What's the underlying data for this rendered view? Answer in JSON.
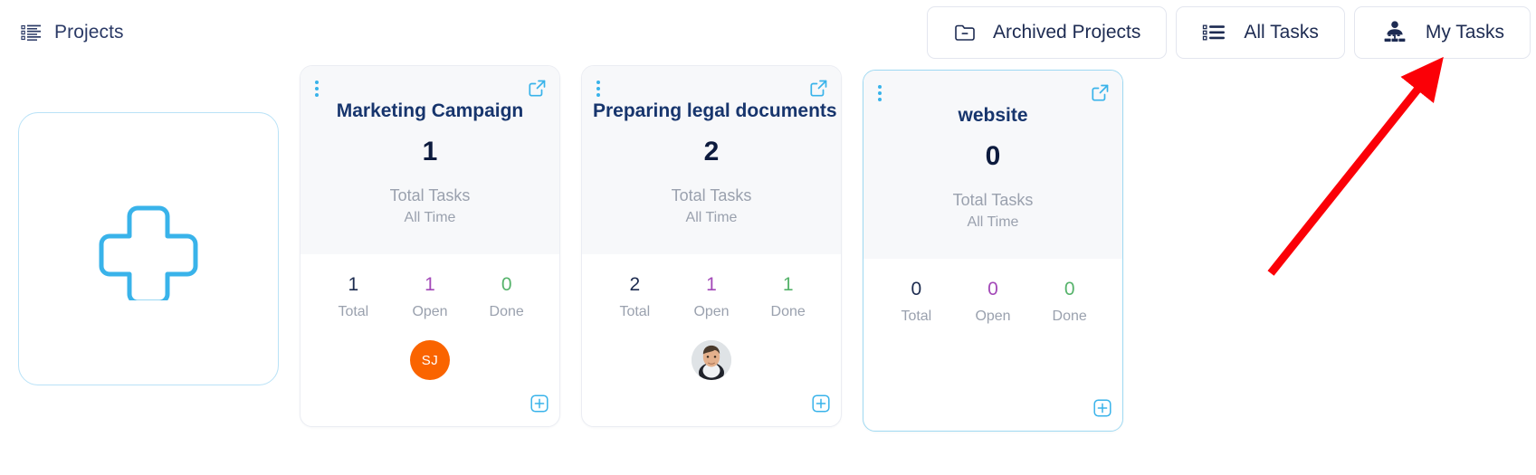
{
  "header": {
    "title": "Projects",
    "title_icon": "list-icon",
    "buttons": [
      {
        "label": "Archived Projects",
        "icon": "folder-minus-icon",
        "name": "archived-projects-button"
      },
      {
        "label": "All Tasks",
        "icon": "list-bullets-icon",
        "name": "all-tasks-button"
      },
      {
        "label": "My Tasks",
        "icon": "org-person-icon",
        "name": "my-tasks-button"
      }
    ]
  },
  "add_card": {
    "icon": "plus-icon",
    "label": ""
  },
  "cards": [
    {
      "title": "Marketing Campaign",
      "count": "1",
      "metric_label": "Total Tasks",
      "metric_sub": "All Time",
      "stats": [
        {
          "num": "1",
          "cap": "Total",
          "kind": "total"
        },
        {
          "num": "1",
          "cap": "Open",
          "kind": "open"
        },
        {
          "num": "0",
          "cap": "Done",
          "kind": "done"
        }
      ],
      "avatar": {
        "type": "initials",
        "initials": "SJ",
        "color": "#fa6400"
      },
      "selected": false
    },
    {
      "title": "Preparing legal documents",
      "count": "2",
      "metric_label": "Total Tasks",
      "metric_sub": "All Time",
      "stats": [
        {
          "num": "2",
          "cap": "Total",
          "kind": "total"
        },
        {
          "num": "1",
          "cap": "Open",
          "kind": "open"
        },
        {
          "num": "1",
          "cap": "Done",
          "kind": "done"
        }
      ],
      "avatar": {
        "type": "photo",
        "initials": "",
        "color": "#d9dde2"
      },
      "selected": false
    },
    {
      "title": "website",
      "count": "0",
      "metric_label": "Total Tasks",
      "metric_sub": "All Time",
      "stats": [
        {
          "num": "0",
          "cap": "Total",
          "kind": "total"
        },
        {
          "num": "0",
          "cap": "Open",
          "kind": "open"
        },
        {
          "num": "0",
          "cap": "Done",
          "kind": "done"
        }
      ],
      "avatar": null,
      "selected": true
    }
  ],
  "card_icons": {
    "menu": "more-vertical-icon",
    "open": "external-link-icon",
    "add": "add-task-icon"
  },
  "annotation": {
    "type": "red-arrow",
    "points_to": "my-tasks-button",
    "color": "#fb0007"
  },
  "colors": {
    "accent_blue": "#39b3ea",
    "title_navy": "#17356d",
    "open_purple": "#a349b8",
    "done_green": "#56b36b",
    "muted_gray": "#9aa1ae"
  }
}
